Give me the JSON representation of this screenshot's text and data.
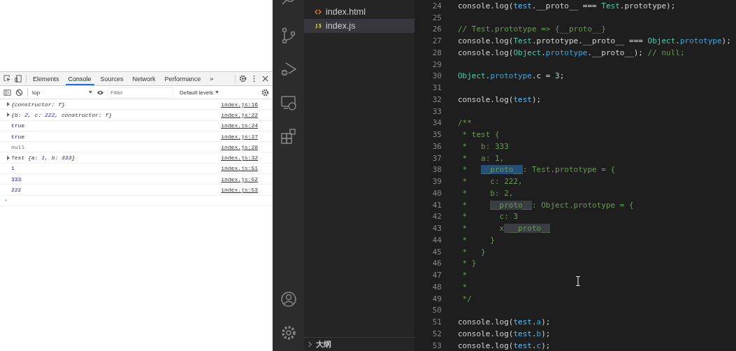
{
  "devtools": {
    "tabs": [
      {
        "label": "Elements",
        "selected": false
      },
      {
        "label": "Console",
        "selected": true
      },
      {
        "label": "Sources",
        "selected": false
      },
      {
        "label": "Network",
        "selected": false
      },
      {
        "label": "Performance",
        "selected": false
      }
    ],
    "more_tabs": "»",
    "context": "top",
    "filter": {
      "placeholder": "Filter"
    },
    "levels": "Default levels",
    "console": [
      {
        "expandable": true,
        "parts": [
          {
            "kind": "plain",
            "text": "{constructor: f}"
          }
        ],
        "source": "index.js:16"
      },
      {
        "expandable": true,
        "parts": [
          {
            "kind": "plain",
            "text": "{b: "
          },
          {
            "kind": "num",
            "text": "2"
          },
          {
            "kind": "plain",
            "text": ", c: "
          },
          {
            "kind": "num",
            "text": "222"
          },
          {
            "kind": "plain",
            "text": ", constructor: f}"
          }
        ],
        "source": "index.js:22"
      },
      {
        "expandable": false,
        "parts": [
          {
            "kind": "value",
            "text": "true"
          }
        ],
        "source": "index.js:24"
      },
      {
        "expandable": false,
        "parts": [
          {
            "kind": "value",
            "text": "true"
          }
        ],
        "source": "index.js:27"
      },
      {
        "expandable": false,
        "parts": [
          {
            "kind": "null",
            "text": "null"
          }
        ],
        "source": "index.js:28"
      },
      {
        "expandable": true,
        "parts": [
          {
            "kind": "plain",
            "text": "Test {a: "
          },
          {
            "kind": "num",
            "text": "1"
          },
          {
            "kind": "plain",
            "text": ", b: "
          },
          {
            "kind": "num",
            "text": "333"
          },
          {
            "kind": "plain",
            "text": "}"
          }
        ],
        "source": "index.js:32"
      },
      {
        "expandable": false,
        "parts": [
          {
            "kind": "value",
            "text": "1"
          }
        ],
        "source": "index.js:51"
      },
      {
        "expandable": false,
        "parts": [
          {
            "kind": "value",
            "text": "333"
          }
        ],
        "source": "index.js:52"
      },
      {
        "expandable": false,
        "parts": [
          {
            "kind": "value",
            "text": "222"
          }
        ],
        "source": "index.js:53"
      }
    ],
    "prompt": "›"
  },
  "explorer": {
    "files": [
      {
        "name": "index.html",
        "kind": "html",
        "selected": false
      },
      {
        "name": "index.js",
        "kind": "js",
        "selected": true
      }
    ],
    "outline": "大纲"
  },
  "editor": {
    "lines": [
      {
        "number": "24",
        "segments": [
          {
            "kind": "plain",
            "text": "console.log("
          },
          {
            "kind": "var",
            "text": "test"
          },
          {
            "kind": "plain",
            "text": ".__proto__ === "
          },
          {
            "kind": "cls",
            "text": "Test"
          },
          {
            "kind": "plain",
            "text": ".prototype);"
          }
        ]
      },
      {
        "number": "25"
      },
      {
        "number": "26",
        "segments": [
          {
            "kind": "cmt",
            "text": "// Test.prototype => {__proto__}"
          }
        ]
      },
      {
        "number": "27",
        "segments": [
          {
            "kind": "plain",
            "text": "console.log("
          },
          {
            "kind": "cls",
            "text": "Test"
          },
          {
            "kind": "plain",
            "text": ".prototype.__proto__ === "
          },
          {
            "kind": "cls",
            "text": "Object"
          },
          {
            "kind": "plain",
            "text": "."
          },
          {
            "kind": "prop",
            "text": "prototype"
          },
          {
            "kind": "plain",
            "text": ");"
          }
        ]
      },
      {
        "number": "28",
        "segments": [
          {
            "kind": "plain",
            "text": "console.log("
          },
          {
            "kind": "cls",
            "text": "Object"
          },
          {
            "kind": "plain",
            "text": "."
          },
          {
            "kind": "prop",
            "text": "prototype"
          },
          {
            "kind": "plain",
            "text": ".__proto__); "
          },
          {
            "kind": "cmt",
            "text": "// null;"
          }
        ]
      },
      {
        "number": "29"
      },
      {
        "number": "30",
        "segments": [
          {
            "kind": "cls",
            "text": "Object"
          },
          {
            "kind": "plain",
            "text": "."
          },
          {
            "kind": "prop",
            "text": "prototype"
          },
          {
            "kind": "plain",
            "text": ".c = "
          },
          {
            "kind": "num",
            "text": "3"
          },
          {
            "kind": "plain",
            "text": ";"
          }
        ]
      },
      {
        "number": "31"
      },
      {
        "number": "32",
        "segments": [
          {
            "kind": "plain",
            "text": "console.log("
          },
          {
            "kind": "var",
            "text": "test"
          },
          {
            "kind": "plain",
            "text": ");"
          }
        ]
      },
      {
        "number": "33"
      },
      {
        "number": "34",
        "segments": [
          {
            "kind": "cmt",
            "text": "/**"
          }
        ]
      },
      {
        "number": "35",
        "segments": [
          {
            "kind": "cmt",
            "text": " * test {"
          }
        ]
      },
      {
        "number": "36",
        "segments": [
          {
            "kind": "cmt",
            "text": " *   b: 333"
          }
        ]
      },
      {
        "number": "37",
        "segments": [
          {
            "kind": "cmt",
            "text": " *   a: 1,"
          }
        ]
      },
      {
        "number": "38",
        "segments": [
          {
            "kind": "cmt",
            "text": " *   "
          },
          {
            "kind": "cmt-selection",
            "text": "__proto__"
          },
          {
            "kind": "cmt",
            "text": ": Test.prototype = {"
          }
        ]
      },
      {
        "number": "39",
        "segments": [
          {
            "kind": "cmt",
            "text": " *     c: 222,"
          }
        ]
      },
      {
        "number": "40",
        "segments": [
          {
            "kind": "cmt",
            "text": " *     b: 2,"
          }
        ]
      },
      {
        "number": "41",
        "segments": [
          {
            "kind": "cmt",
            "text": " *     "
          },
          {
            "kind": "cmt-match",
            "text": "__proto__"
          },
          {
            "kind": "cmt",
            "text": ": Object.prototype = {"
          }
        ]
      },
      {
        "number": "42",
        "segments": [
          {
            "kind": "cmt",
            "text": " *       c: 3"
          }
        ]
      },
      {
        "number": "43",
        "segments": [
          {
            "kind": "cmt",
            "text": " *       x"
          },
          {
            "kind": "cmt-match",
            "text": " __proto__"
          }
        ]
      },
      {
        "number": "44",
        "segments": [
          {
            "kind": "cmt",
            "text": " *     }"
          }
        ]
      },
      {
        "number": "45",
        "segments": [
          {
            "kind": "cmt",
            "text": " *   }"
          }
        ]
      },
      {
        "number": "46",
        "segments": [
          {
            "kind": "cmt",
            "text": " * }"
          }
        ]
      },
      {
        "number": "47",
        "segments": [
          {
            "kind": "cmt",
            "text": " *"
          }
        ]
      },
      {
        "number": "48",
        "segments": [
          {
            "kind": "cmt",
            "text": " *"
          }
        ]
      },
      {
        "number": "49",
        "segments": [
          {
            "kind": "cmt",
            "text": " */"
          }
        ]
      },
      {
        "number": "50"
      },
      {
        "number": "51",
        "segments": [
          {
            "kind": "plain",
            "text": "console.log("
          },
          {
            "kind": "var",
            "text": "test"
          },
          {
            "kind": "plain",
            "text": "."
          },
          {
            "kind": "prop",
            "text": "a"
          },
          {
            "kind": "plain",
            "text": ");"
          }
        ]
      },
      {
        "number": "52",
        "segments": [
          {
            "kind": "plain",
            "text": "console.log("
          },
          {
            "kind": "var",
            "text": "test"
          },
          {
            "kind": "plain",
            "text": "."
          },
          {
            "kind": "prop",
            "text": "b"
          },
          {
            "kind": "plain",
            "text": ");"
          }
        ]
      },
      {
        "number": "53",
        "segments": [
          {
            "kind": "plain",
            "text": "console.log("
          },
          {
            "kind": "var",
            "text": "test"
          },
          {
            "kind": "plain",
            "text": "."
          },
          {
            "kind": "prop",
            "text": "c"
          },
          {
            "kind": "plain",
            "text": ");"
          }
        ]
      }
    ]
  }
}
